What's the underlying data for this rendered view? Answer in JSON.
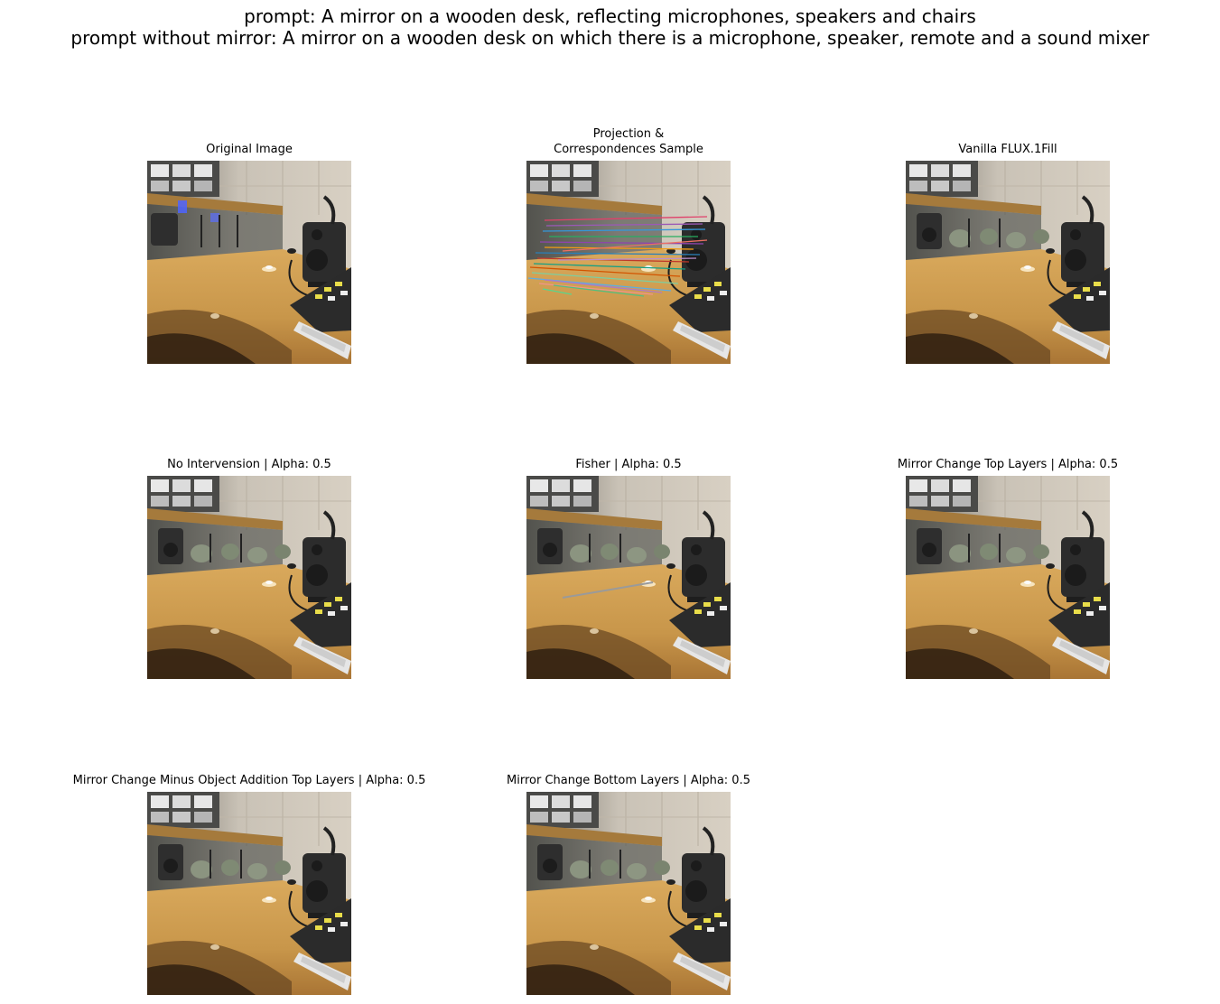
{
  "suptitle": {
    "line1": "prompt: A mirror on a wooden desk, reflecting microphones, speakers and chairs",
    "line2": "prompt without mirror: A mirror on a wooden desk on which there is a microphone, speaker, remote and a sound mixer"
  },
  "panels": [
    {
      "title_line1": "Original Image",
      "title_line2": ""
    },
    {
      "title_line1": "Projection &",
      "title_line2": "Correspondences Sample"
    },
    {
      "title_line1": "Vanilla FLUX.1Fill",
      "title_line2": ""
    },
    {
      "title_line1": "No Intervension | Alpha: 0.5",
      "title_line2": ""
    },
    {
      "title_line1": "Fisher | Alpha: 0.5",
      "title_line2": ""
    },
    {
      "title_line1": "Mirror Change Top Layers | Alpha: 0.5",
      "title_line2": ""
    },
    {
      "title_line1": "Mirror Change Minus Object Addition Top Layers | Alpha: 0.5",
      "title_line2": ""
    },
    {
      "title_line1": "Mirror Change Bottom Layers | Alpha: 0.5",
      "title_line2": ""
    }
  ]
}
